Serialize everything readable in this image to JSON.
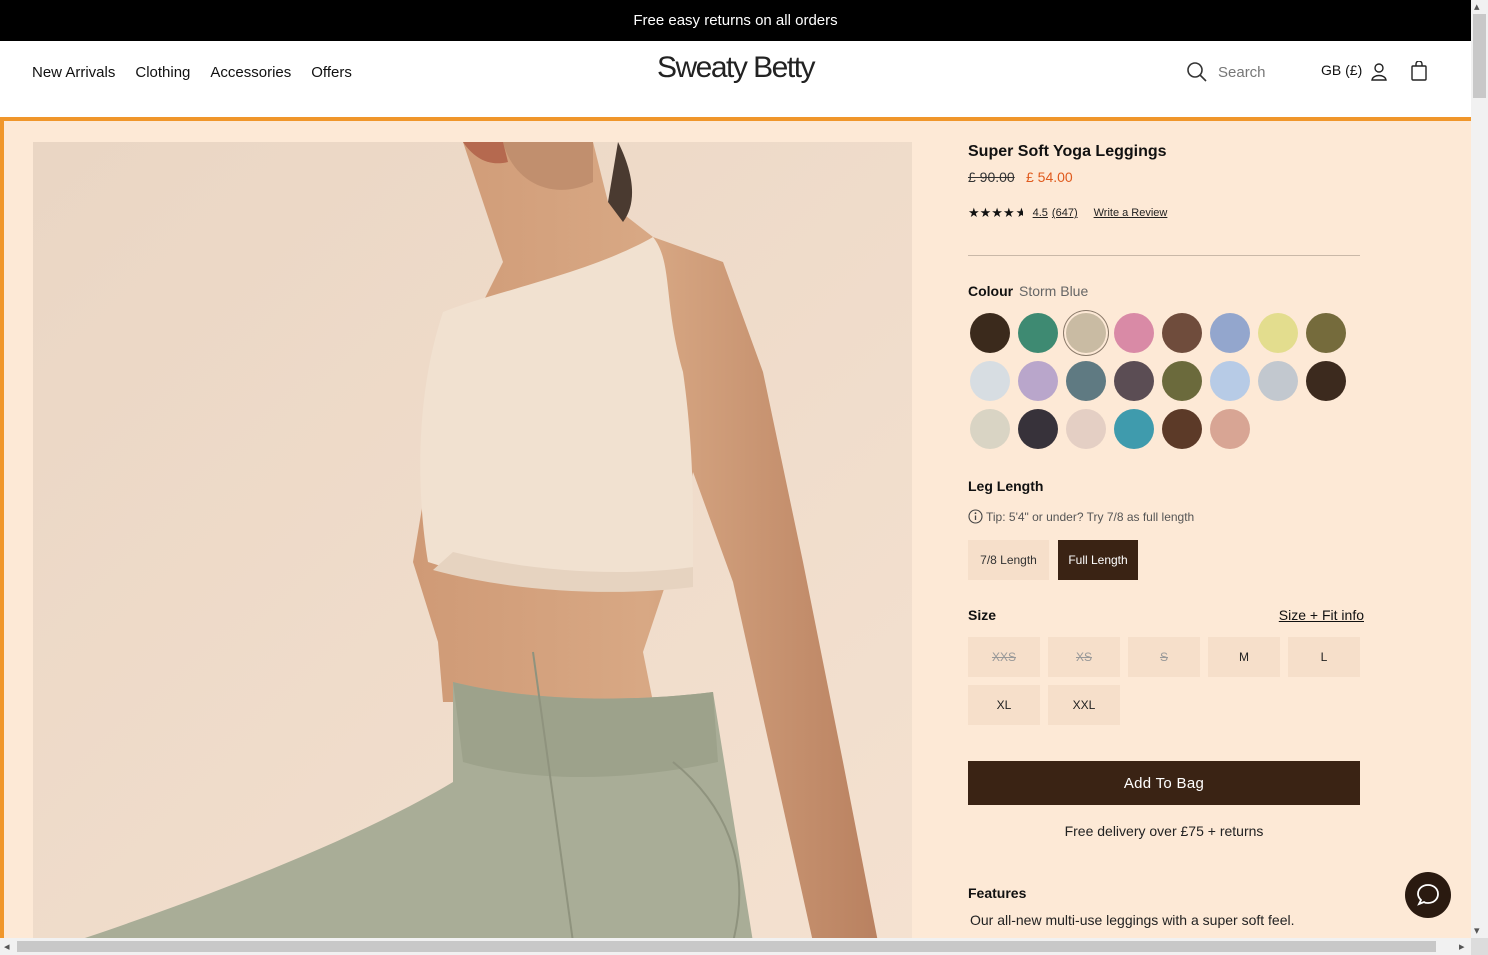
{
  "announcement": "Free easy returns on all orders",
  "nav": {
    "items": [
      "New Arrivals",
      "Clothing",
      "Accessories",
      "Offers"
    ]
  },
  "logo": "Sweaty Betty",
  "search": {
    "placeholder": "Search"
  },
  "region": "GB (£)",
  "product": {
    "title": "Super Soft Yoga Leggings",
    "price_old": "£ 90.00",
    "price_new": "£ 54.00",
    "rating": "4.5",
    "reviews": "(647)",
    "write_review": "Write a Review",
    "colour_label": "Colour",
    "colour_value": "Storm Blue",
    "swatches": [
      {
        "color": "#3b2a1c",
        "name": "dark-brown"
      },
      {
        "color": "#3e8a72",
        "name": "green"
      },
      {
        "color": "#c9bba3",
        "name": "stone",
        "selected": true
      },
      {
        "color": "#d98aa6",
        "name": "pink-print"
      },
      {
        "color": "#6f4c3c",
        "name": "brown"
      },
      {
        "color": "#93a6cd",
        "name": "periwinkle"
      },
      {
        "color": "#e3dd8e",
        "name": "lemon"
      },
      {
        "color": "#756b3c",
        "name": "olive-stripe"
      },
      {
        "color": "#d7dde2",
        "name": "grey-stripe"
      },
      {
        "color": "#b9a6cb",
        "name": "leopard"
      },
      {
        "color": "#5f7a82",
        "name": "grey-ombre"
      },
      {
        "color": "#5b4d54",
        "name": "dark-print"
      },
      {
        "color": "#6b6a3c",
        "name": "forest-print"
      },
      {
        "color": "#b7cbe6",
        "name": "blue-tie-dye"
      },
      {
        "color": "#c2c8cf",
        "name": "silver-sparkle"
      },
      {
        "color": "#3c2a1e",
        "name": "brown-stripe"
      },
      {
        "color": "#d9d4c4",
        "name": "floral-print"
      },
      {
        "color": "#37323a",
        "name": "dark-dash"
      },
      {
        "color": "#e4cfc4",
        "name": "blush-ombre"
      },
      {
        "color": "#3f9bad",
        "name": "teal-marble"
      },
      {
        "color": "#5c3a28",
        "name": "chocolate-print"
      },
      {
        "color": "#d8a594",
        "name": "rose"
      }
    ],
    "leg_label": "Leg Length",
    "tip": "Tip: 5'4\" or under? Try 7/8 as full length",
    "lengths": [
      "7/8 Length",
      "Full Length"
    ],
    "size_label": "Size",
    "size_fit": "Size + Fit info",
    "sizes": [
      {
        "label": "XXS",
        "available": false
      },
      {
        "label": "XS",
        "available": false
      },
      {
        "label": "S",
        "available": false
      },
      {
        "label": "M",
        "available": true
      },
      {
        "label": "L",
        "available": true
      },
      {
        "label": "XL",
        "available": true
      },
      {
        "label": "XXL",
        "available": true
      }
    ],
    "add_to_bag": "Add To Bag",
    "delivery": "Free delivery over £75 + returns",
    "features_label": "Features",
    "features_text": "Our all-new multi-use leggings with a super soft feel."
  },
  "colors": {
    "accent": "#3a2314",
    "sale": "#e05a1d",
    "panel": "#fde9d6",
    "frame": "#f0962a"
  }
}
